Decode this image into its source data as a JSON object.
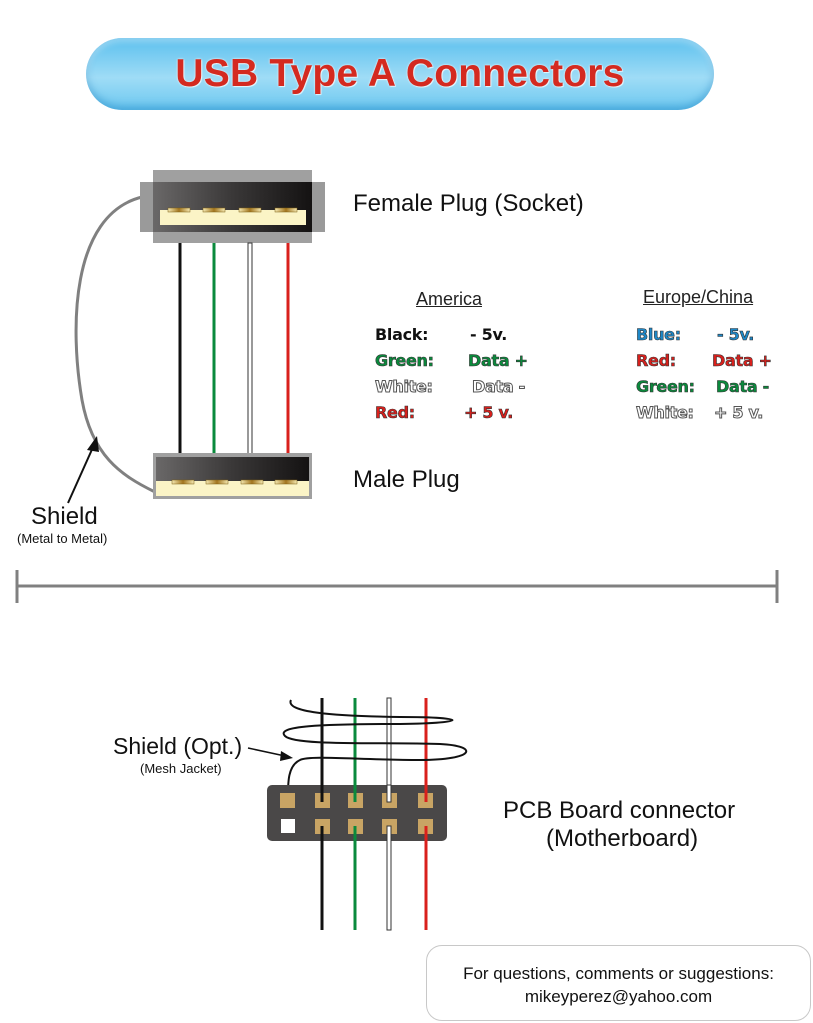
{
  "title": "USB Type A Connectors",
  "labels": {
    "female_plug": "Female Plug (Socket)",
    "male_plug": "Male Plug",
    "shield": "Shield",
    "shield_sub": "(Metal to Metal)",
    "shield_opt": "Shield (Opt.)",
    "shield_opt_sub": "(Mesh Jacket)",
    "pcb_line1": "PCB Board connector",
    "pcb_line2": "(Motherboard)"
  },
  "wire_colors": {
    "black": "#111111",
    "green": "#0a8a3c",
    "white": "#ffffff",
    "red": "#d9201c",
    "blue": "#1e88c8",
    "shield": "#808080",
    "pad": "#c8a464",
    "board": "#4a4848"
  },
  "legends": [
    {
      "heading": "America",
      "rows": [
        {
          "color_name": "Black:",
          "meaning": "- 5v.",
          "color": "black"
        },
        {
          "color_name": "Green:",
          "meaning": "Data +",
          "color": "green"
        },
        {
          "color_name": "White:",
          "meaning": "Data -",
          "color": "white"
        },
        {
          "color_name": "Red:",
          "meaning": "+ 5 v.",
          "color": "red"
        }
      ]
    },
    {
      "heading": "Europe/China",
      "rows": [
        {
          "color_name": "Blue:",
          "meaning": "- 5v.",
          "color": "blue"
        },
        {
          "color_name": "Red:",
          "meaning": "Data +",
          "color": "red"
        },
        {
          "color_name": "Green:",
          "meaning": "Data -",
          "color": "green"
        },
        {
          "color_name": "White:",
          "meaning": "+ 5 v.",
          "color": "white"
        }
      ]
    }
  ],
  "contact": {
    "line1": "For questions, comments or suggestions:",
    "line2": "mikeyperez@yahoo.com"
  }
}
